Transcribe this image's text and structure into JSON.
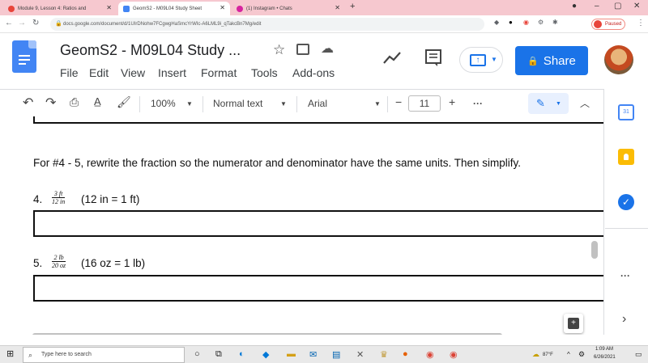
{
  "browser": {
    "tabs": [
      {
        "label": "Module 9, Lesson 4: Ratios and",
        "favicon_color": "#e8443a"
      },
      {
        "label": "GeomS2 - M09L04 Study Sheet",
        "favicon_color": "#4285f4"
      },
      {
        "label": "(1) Instagram • Chats",
        "favicon_color": "#d6249f"
      }
    ],
    "new_tab": "+",
    "url": "docs.google.com/document/d/1UIrDNohw7FCgwgHaSmcYrWIc-A6LML9i_qTakcBn7Mg/edit",
    "profile_label": "Paused"
  },
  "docs": {
    "title": "GeomS2 - M09L04 Study ...",
    "menu": [
      "File",
      "Edit",
      "View",
      "Insert",
      "Format",
      "Tools",
      "Add-ons"
    ],
    "share_label": "Share",
    "toolbar": {
      "zoom": "100%",
      "style": "Normal text",
      "font": "Arial",
      "size": "11",
      "minus": "−",
      "plus": "+",
      "more": "···"
    }
  },
  "document": {
    "instruction": "For #4 - 5, rewrite the fraction so the numerator and denominator have the same units.  Then simplify.",
    "questions": [
      {
        "number": "4.",
        "frac_num": "3 ft",
        "frac_den": "12 in",
        "hint": "(12 in = 1 ft)"
      },
      {
        "number": "5.",
        "frac_num": "2 lb",
        "frac_den": "20 oz",
        "hint": "(16 oz = 1 lb)"
      }
    ]
  },
  "side_panel": {
    "calendar_day": "31",
    "more": "···",
    "expand": "›"
  },
  "taskbar": {
    "search_placeholder": "Type here to search",
    "temperature": "87°F",
    "time": "1:09 AM",
    "date": "6/26/2021"
  },
  "colors": {
    "tab_strip": "#f6c8cf",
    "share_button": "#1a73e8",
    "docs_blue": "#4285f4"
  }
}
